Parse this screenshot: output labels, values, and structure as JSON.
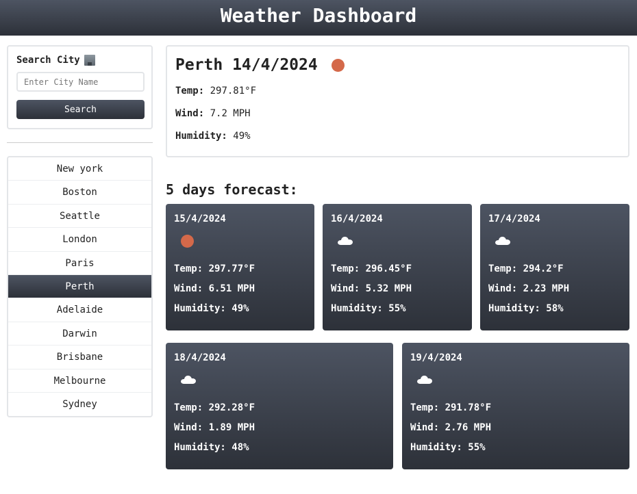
{
  "header": {
    "title": "Weather Dashboard"
  },
  "search": {
    "title": "Search City",
    "icon": "office-building-icon",
    "placeholder": "Enter City Name",
    "value": "",
    "button_label": "Search"
  },
  "cities": [
    "New york",
    "Boston",
    "Seattle",
    "London",
    "Paris",
    "Perth",
    "Adelaide",
    "Darwin",
    "Brisbane",
    "Melbourne",
    "Sydney"
  ],
  "active_city": "Perth",
  "current": {
    "title": "Perth 14/4/2024",
    "icon": "sun-icon",
    "temp_label": "Temp:",
    "temp": "297.81°F",
    "wind_label": "Wind:",
    "wind": "7.2 MPH",
    "humidity_label": "Humidity:",
    "humidity": "49%"
  },
  "forecast": {
    "title": "5 days forecast:",
    "days": [
      {
        "date": "15/4/2024",
        "icon": "sun-icon",
        "temp": "297.77°F",
        "wind": "6.51 MPH",
        "humidity": "49%"
      },
      {
        "date": "16/4/2024",
        "icon": "cloud-icon",
        "temp": "296.45°F",
        "wind": "5.32 MPH",
        "humidity": "55%"
      },
      {
        "date": "17/4/2024",
        "icon": "cloud-icon",
        "temp": "294.2°F",
        "wind": "2.23 MPH",
        "humidity": "58%"
      },
      {
        "date": "18/4/2024",
        "icon": "cloud-icon",
        "temp": "292.28°F",
        "wind": "1.89 MPH",
        "humidity": "48%"
      },
      {
        "date": "19/4/2024",
        "icon": "cloud-icon",
        "temp": "291.78°F",
        "wind": "2.76 MPH",
        "humidity": "55%"
      }
    ]
  },
  "colors": {
    "sun": "#d4694a",
    "header_top": "#4d5462",
    "header_bottom": "#2d3139"
  }
}
